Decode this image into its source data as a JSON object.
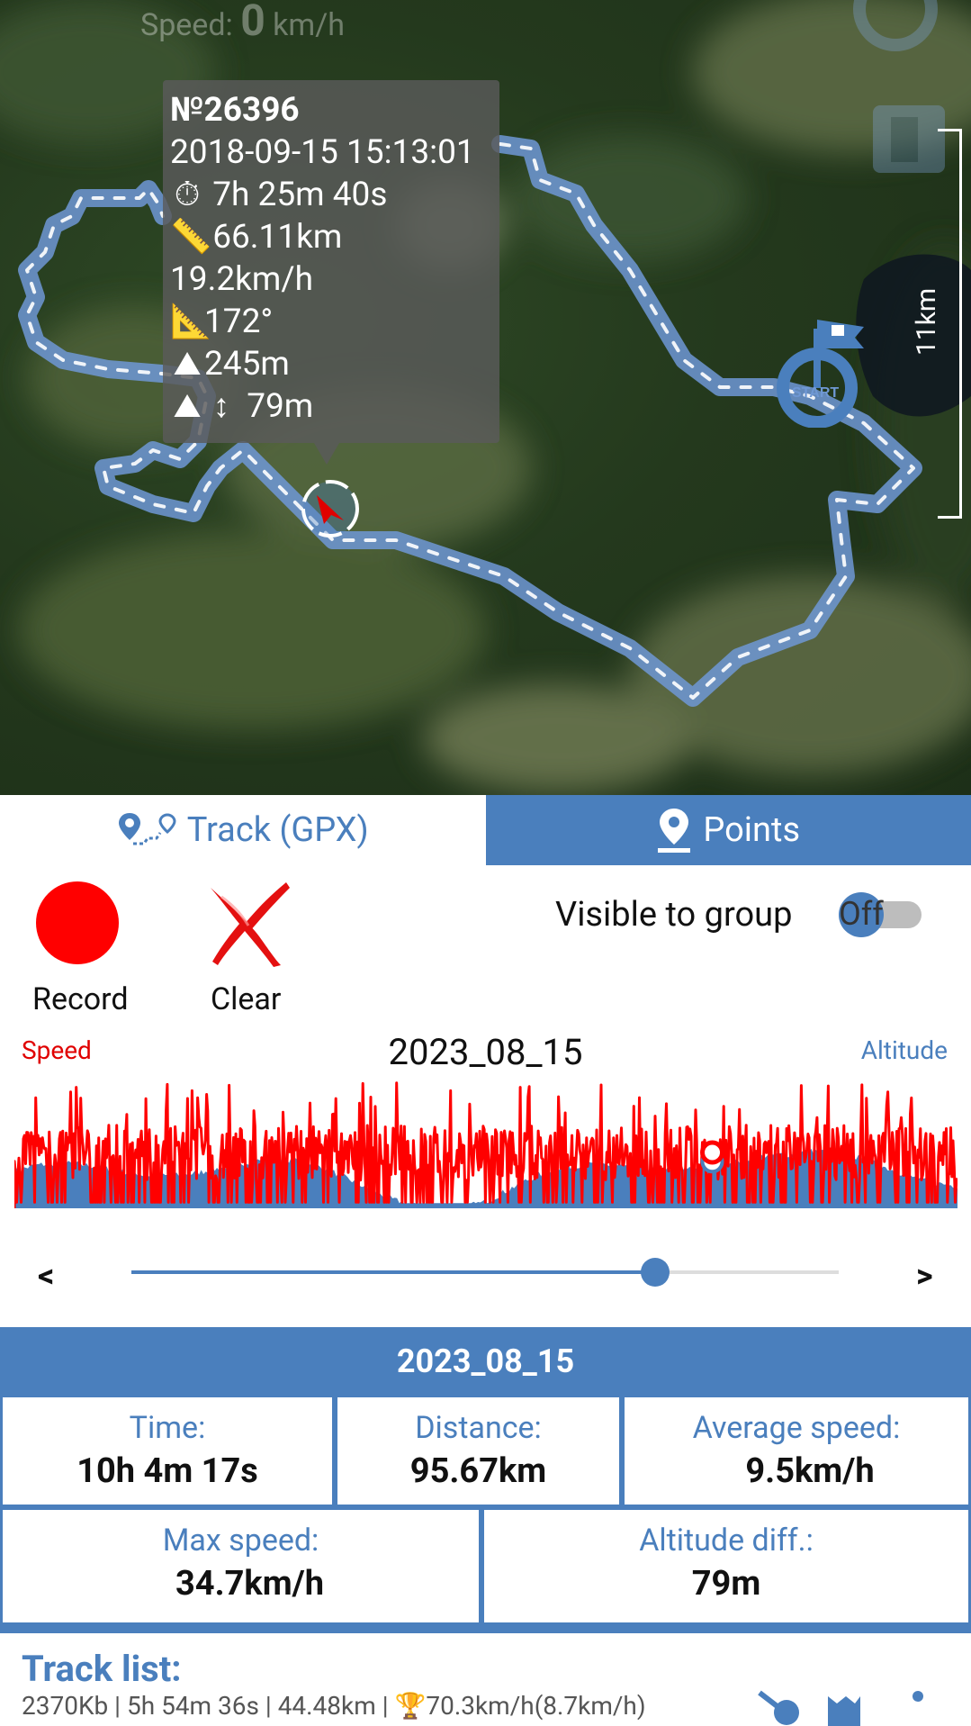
{
  "map": {
    "speed_label": "Speed:",
    "speed_value": "0",
    "speed_unit": "km/h",
    "scale_label": "11km",
    "start_label": "START",
    "track_color": "#a9c6ee",
    "tooltip": {
      "id": "№26396",
      "datetime": "2018-09-15 15:13:01",
      "duration": "7h 25m 40s",
      "distance": "66.11km",
      "speed": "19.2km/h",
      "bearing": "172°",
      "altitude": "245m",
      "altitude_diff": "79m",
      "icons": [
        "stopwatch-icon",
        "ruler-icon",
        "angle-icon",
        "mountain-icon",
        "mountain-icon",
        "updown-arrow-icon"
      ]
    }
  },
  "tabs": [
    {
      "label": "Track (GPX)",
      "icon": "track-route-icon",
      "active": true
    },
    {
      "label": "Points",
      "icon": "map-pin-icon",
      "active": false
    }
  ],
  "controls": {
    "record_label": "Record",
    "clear_label": "Clear",
    "visible_label": "Visible to group",
    "toggle_text": "Off"
  },
  "chart": {
    "speed_label": "Speed",
    "altitude_label": "Altitude",
    "date": "2023_08_15",
    "speed_color": "#ff0000",
    "altitude_color": "#4a7fbd",
    "cursor_fraction": 0.74
  },
  "slider": {
    "prev": "<",
    "next": ">",
    "position_fraction": 0.74
  },
  "stats": {
    "title": "2023_08_15",
    "time_label": "Time:",
    "time_value": "10h 4m 17s",
    "distance_label": "Distance:",
    "distance_value": "95.67km",
    "avg_label": "Average speed:",
    "avg_value": "9.5km/h",
    "max_label": "Max speed:",
    "max_value": "34.7km/h",
    "alt_label": "Altitude diff.:",
    "alt_value": "79m"
  },
  "track_list": {
    "title": "Track list:",
    "row_text": "2370Kb | 5h 54m 36s | 44.48km | ",
    "row_trophy_text": "70.3km/h(8.7km/h)"
  },
  "colors": {
    "accent": "#4a7fbd",
    "record": "#ff0000"
  }
}
